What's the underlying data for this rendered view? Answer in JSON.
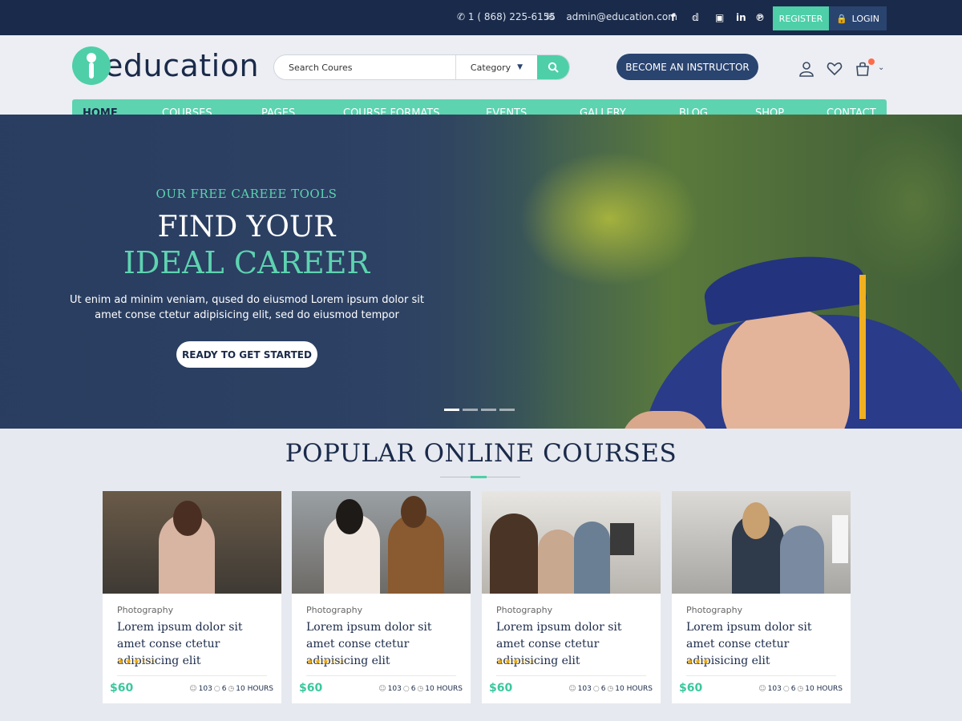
{
  "topbar": {
    "phone": "1 ( 868) 225-6155",
    "email": "admin@education.com",
    "social": [
      "facebook",
      "twitter",
      "instagram",
      "linkedin",
      "pinterest"
    ],
    "register_label": "REGISTER",
    "login_label": "LOGIN"
  },
  "header": {
    "logo_text": "education",
    "search_placeholder": "Search Coures",
    "category_label": "Category",
    "instructor_label": "BECOME AN INSTRUCTOR",
    "cart_count": "0"
  },
  "nav": {
    "items": [
      "HOME",
      "COURSES",
      "PAGES",
      "COURSE FORMATS",
      "EVENTS",
      "GALLERY",
      "BLOG",
      "SHOP",
      "CONTACT"
    ],
    "active": "HOME"
  },
  "hero": {
    "subtitle": "OUR FREE CAREEE TOOLS",
    "title_line1": "FIND YOUR",
    "title_line2": "IDEAL CAREER",
    "text": "Ut enim ad minim veniam, qused do eiusmod  Lorem ipsum dolor sit amet conse ctetur adipisicing elit, sed do eiusmod tempor",
    "button_label": "READY TO GET STARTED",
    "slides": 4,
    "active_slide": 1
  },
  "courses": {
    "title": "POPULAR ONLINE COURSES",
    "items": [
      {
        "category": "Photography",
        "title": "Lorem ipsum dolor sit amet conse ctetur adipisicing elit",
        "rating": 3,
        "stars": "★★★☆☆",
        "price": "$60",
        "students": "103",
        "comments": "6",
        "hours": "10 HOURS"
      },
      {
        "category": "Photography",
        "title": "Lorem ipsum dolor sit amet conse ctetur adipisicing elit",
        "rating": 3,
        "stars": "★★★☆☆",
        "price": "$60",
        "students": "103",
        "comments": "6",
        "hours": "10 HOURS"
      },
      {
        "category": "Photography",
        "title": "Lorem ipsum dolor sit amet conse ctetur adipisicing elit",
        "rating": 3,
        "stars": "★★★☆☆",
        "price": "$60",
        "students": "103",
        "comments": "6",
        "hours": "10 HOURS"
      },
      {
        "category": "Photography",
        "title": "Lorem ipsum dolor sit amet conse ctetur adipisicing elit",
        "rating": 3,
        "stars": "★★★",
        "price": "$60",
        "students": "103",
        "comments": "6",
        "hours": "10 HOURS"
      }
    ]
  },
  "colors": {
    "navy": "#1a2a4a",
    "accent": "#4ecfa8",
    "button_dark": "#2a4470",
    "star": "#f0a800"
  }
}
